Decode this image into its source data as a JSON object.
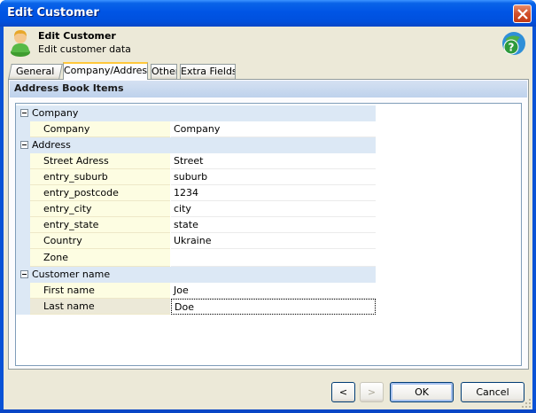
{
  "window": {
    "title": "Edit Customer"
  },
  "header": {
    "title": "Edit Customer",
    "subtitle": "Edit customer data"
  },
  "tabs": [
    {
      "label": "General",
      "active": false
    },
    {
      "label": "Company/Address",
      "active": true
    },
    {
      "label": "Other",
      "active": false
    },
    {
      "label": "Extra Fields",
      "active": false
    }
  ],
  "panel": {
    "section_title": "Address Book Items"
  },
  "grid": {
    "categories": [
      {
        "label": "Company",
        "properties": [
          {
            "name": "Company",
            "value": "Company"
          }
        ]
      },
      {
        "label": "Address",
        "properties": [
          {
            "name": "Street Adress",
            "value": "Street"
          },
          {
            "name": "entry_suburb",
            "value": "suburb"
          },
          {
            "name": "entry_postcode",
            "value": "1234"
          },
          {
            "name": "entry_city",
            "value": "city"
          },
          {
            "name": "entry_state",
            "value": "state"
          },
          {
            "name": "Country",
            "value": "Ukraine"
          },
          {
            "name": "Zone",
            "value": ""
          }
        ]
      },
      {
        "label": "Customer name",
        "properties": [
          {
            "name": "First name",
            "value": "Joe"
          },
          {
            "name": "Last name",
            "value": "Doe"
          }
        ]
      }
    ]
  },
  "buttons": {
    "prev_label": "<",
    "next_label": ">",
    "ok_label": "OK",
    "cancel_label": "Cancel"
  },
  "colors": {
    "titlebar": "#0055e5",
    "dialog_bg": "#ece9d8",
    "category_bg": "#dce8f5",
    "property_name_bg": "#fdfde2",
    "active_tab_highlight": "#ffc83c"
  }
}
